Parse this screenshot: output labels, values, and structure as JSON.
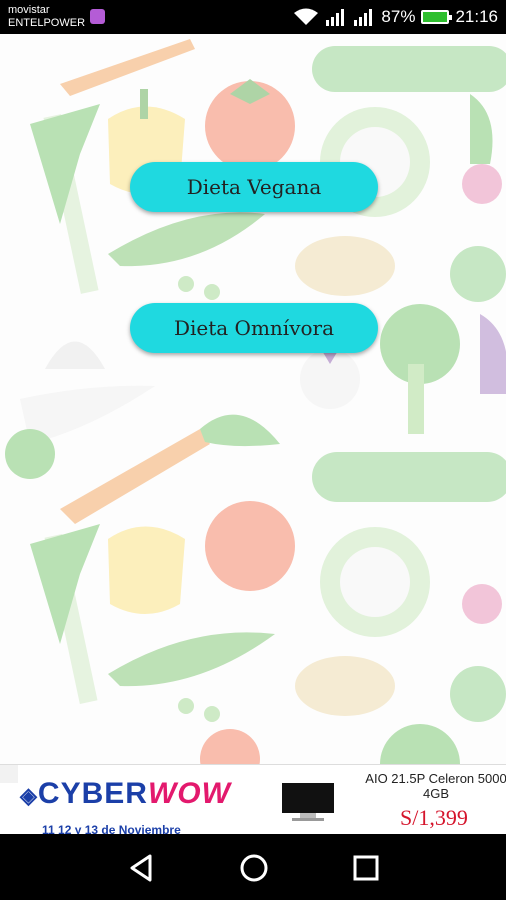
{
  "status_bar": {
    "carrier_line1": "movistar",
    "carrier_line2": "ENTELPOWER",
    "battery_percent": "87%",
    "time": "21:16",
    "icons": [
      "wifi-icon",
      "signal-icon",
      "signal-icon",
      "battery-icon"
    ]
  },
  "menu": {
    "vegan_label": "Dieta Vegana",
    "omnivore_label": "Dieta Omnívora",
    "button_color": "#1fd9e0"
  },
  "ad": {
    "brand_cyber": "CYBER",
    "brand_wow": "WOW",
    "dates": "11 12 y 13 de Noviembre",
    "product_title": "AIO 21.5P Celeron 5000",
    "product_subtitle": "4GB",
    "price": "S/1,399"
  },
  "nav": {
    "back": "back-icon",
    "home": "home-icon",
    "recents": "recents-icon"
  }
}
